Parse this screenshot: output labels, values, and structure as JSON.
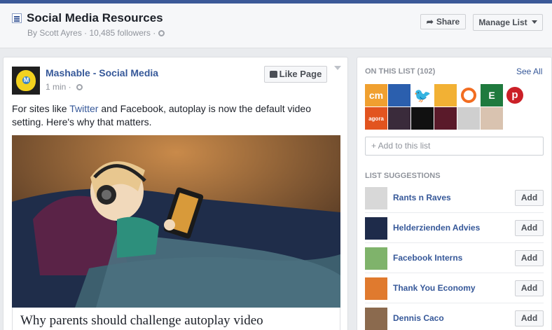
{
  "header": {
    "title": "Social Media Resources",
    "byline": "By Scott Ayres · 10,485 followers ·",
    "share_label": "Share",
    "manage_label": "Manage List"
  },
  "post": {
    "page_name": "Mashable - Social Media",
    "time": "1 min ·",
    "like_label": "Like Page",
    "text_before": "For sites like ",
    "text_link": "Twitter",
    "text_after": " and Facebook, autoplay is now the default video setting. Here's why that matters.",
    "article_title": "Why parents should challenge autoplay video"
  },
  "sidebar": {
    "on_list_label": "ON THIS LIST (102)",
    "see_all": "See All",
    "add_placeholder": "+ Add to this list",
    "suggestions_label": "LIST SUGGESTIONS",
    "members": [
      {
        "icon": "cm-logo-icon",
        "color": "#f0a030",
        "text": "cm"
      },
      {
        "icon": "mask-icon",
        "color": "#2b5fae",
        "text": ""
      },
      {
        "icon": "twitter-bird-icon",
        "color": "#ffffff",
        "text": ""
      },
      {
        "icon": "yellow-logo-icon",
        "color": "#f2b134",
        "text": ""
      },
      {
        "icon": "orange-ring-icon",
        "color": "#ffffff",
        "text": ""
      },
      {
        "icon": "e-logo-icon",
        "color": "#1f7a3e",
        "text": "E"
      },
      {
        "icon": "pinterest-icon",
        "color": "#ffffff",
        "text": ""
      },
      {
        "icon": "agorapulse-icon",
        "color": "#e2541f",
        "text": "agora"
      },
      {
        "icon": "dark-icon",
        "color": "#3a2b3b",
        "text": ""
      },
      {
        "icon": "black-icon",
        "color": "#111111",
        "text": ""
      },
      {
        "icon": "round-badge-icon",
        "color": "#5a1a2a",
        "text": ""
      },
      {
        "icon": "person-photo-icon",
        "color": "#cfcfcf",
        "text": ""
      },
      {
        "icon": "woman-photo-icon",
        "color": "#d9c3b0",
        "text": ""
      }
    ],
    "suggestions": [
      {
        "name": "Rants n Raves",
        "add": "Add",
        "color": "#d8d8d8"
      },
      {
        "name": "Helderzienden Advies",
        "add": "Add",
        "color": "#1e2b4a"
      },
      {
        "name": "Facebook Interns",
        "add": "Add",
        "color": "#7fb36b"
      },
      {
        "name": "Thank You Economy",
        "add": "Add",
        "color": "#e07a2e"
      },
      {
        "name": "Dennis Caco",
        "add": "Add",
        "color": "#8b6a4e"
      }
    ]
  }
}
